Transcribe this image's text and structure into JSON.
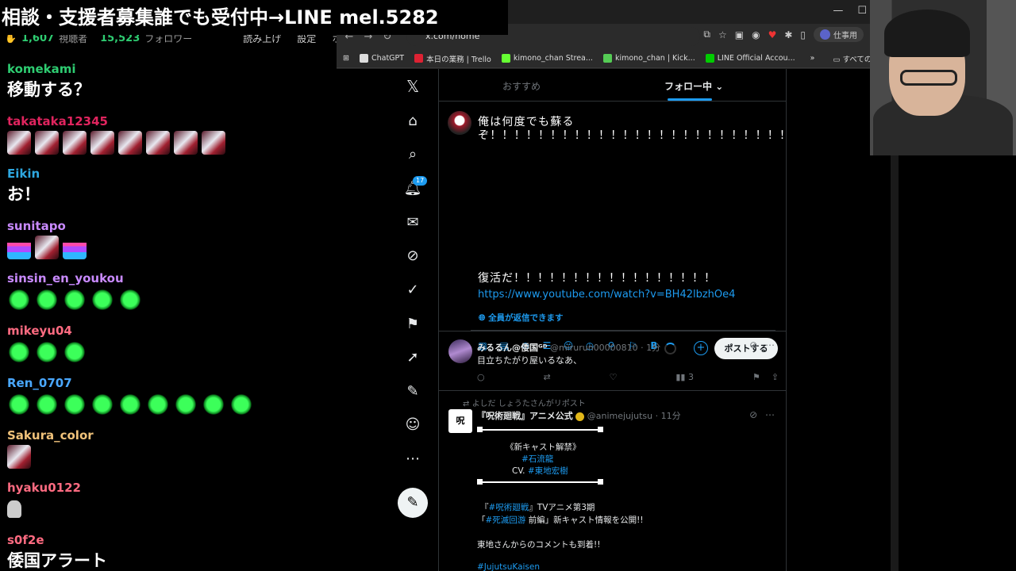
{
  "banner": {
    "text": "相談・支援者募集誰でも受付中→LINE mel.5282"
  },
  "chat": {
    "stats": {
      "viewers": "1,607",
      "viewers_label": "視聴者",
      "followers": "15,523",
      "followers_label": "フォロワー",
      "menu": [
        "読み上げ",
        "設定",
        "ホー"
      ]
    },
    "messages": [
      {
        "user": "komekami",
        "color": "#2ecc71",
        "text": "移動する？"
      },
      {
        "user": "takataka12345",
        "color": "#e0245e",
        "emotes": [
          "girl",
          "girl",
          "girl",
          "girl",
          "girl",
          "girl",
          "girl",
          "girl"
        ]
      },
      {
        "user": "Eikin",
        "color": "#2ea7e0",
        "text": "お！"
      },
      {
        "user": "sunitapo",
        "color": "#c98aff",
        "emotes": [
          "wave",
          "girl",
          "wave"
        ]
      },
      {
        "user": "sinsin_en_youkou",
        "color": "#c98aff",
        "emotes": [
          "leaf",
          "leaf",
          "leaf",
          "leaf",
          "leaf"
        ]
      },
      {
        "user": "mikeyu04",
        "color": "#ff6b81",
        "emotes": [
          "leaf",
          "leaf",
          "leaf"
        ]
      },
      {
        "user": "Ren_0707",
        "color": "#4aa8ff",
        "emotes": [
          "leaf",
          "leaf",
          "leaf",
          "leaf",
          "leaf",
          "leaf",
          "leaf",
          "leaf",
          "leaf"
        ]
      },
      {
        "user": "Sakura_color",
        "color": "#f0c27a",
        "emotes": [
          "girl"
        ]
      },
      {
        "user": "hyaku0122",
        "color": "#ff6b81",
        "emotes": [
          "tiny"
        ]
      },
      {
        "user": "s0f2e",
        "color": "#ff6b81",
        "text": "倭国アラート"
      }
    ]
  },
  "browser": {
    "url": "x.com/home",
    "profile": "仕事用",
    "bookmarks": [
      {
        "label": "ChatGPT",
        "color": "#ddd"
      },
      {
        "label": "本日の業務 | Trello",
        "color": "#d23"
      },
      {
        "label": "kimono_chan Strea...",
        "color": "#6f3"
      },
      {
        "label": "kimono_chan | Kick...",
        "color": "#5c5"
      },
      {
        "label": "LINE Official Accou...",
        "color": "#0c0"
      }
    ],
    "bookmarks_more": "»",
    "bookmarks_folder": "すべてのブ"
  },
  "x": {
    "tabs": [
      {
        "label": "おすすめ"
      },
      {
        "label": "フォロー中"
      }
    ],
    "notif_badge": "17",
    "compose": {
      "text": "俺は何度でも蘇るぞ！！！！！！！！！！！！！！！！！！！！！！！！！！！！！！！！！！！！！！！！！！！！！！！！！！！！！",
      "text2": "復活だ！！！！！！！！！！！！！！！！！",
      "link": "https://www.youtube.com/watch?v=BH42lbzhOe4",
      "reply_setting": "全員が返信できます",
      "post_button": "ポストする"
    },
    "tweet1": {
      "name": "みるるん@倭国ᴳᴰ",
      "handle": "@mirurun00000810 · 1分",
      "text": "目立ちたがり屋いるなあ、",
      "views": "3"
    },
    "tweet2": {
      "repost_line": "よしだ しょうたさんがリポスト",
      "avatar_text": "呪",
      "name": "『呪術廻戦』アニメ公式",
      "handle": "@animejujutsu · 11分",
      "l1": "《新キャスト解禁》",
      "l2": "#石流龍",
      "l3a": "CV. ",
      "l3b": "#東地宏樹",
      "l4a": "『",
      "l4b": "#呪術廻戦",
      "l4c": "』TVアニメ第3期",
      "l5a": "「",
      "l5b": "#死滅回游",
      "l5c": " 前編」新キャスト情報を公開!!",
      "l6": "東地さんからのコメントも到着!!",
      "l7": "#JujutsuKaisen"
    }
  }
}
